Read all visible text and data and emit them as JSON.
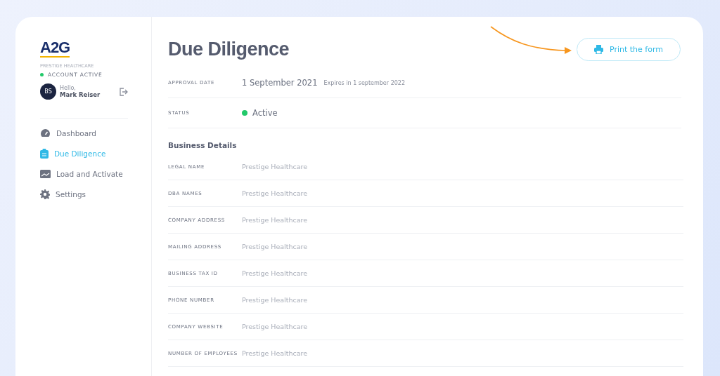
{
  "logo": {
    "text": "A2G"
  },
  "account": {
    "company": "PRESTIGE HEALTHCARE",
    "status": "ACCOUNT ACTIVE",
    "active": true,
    "initials": "BS",
    "greeting": "Hello,",
    "name": "Mark Reiser"
  },
  "nav": [
    {
      "kind": "dashboard",
      "label": "Dashboard",
      "selected": false
    },
    {
      "kind": "diligence",
      "label": "Due Diligence",
      "selected": true
    },
    {
      "kind": "load",
      "label": "Load and Activate",
      "selected": false
    },
    {
      "kind": "settings",
      "label": "Settings",
      "selected": false
    }
  ],
  "page": {
    "title": "Due Diligence",
    "print_button": "Print the form"
  },
  "approval": {
    "label": "APPROVAL DATE",
    "date": "1 September 2021",
    "expires": "Expires in 1 september 2022"
  },
  "status": {
    "label": "STATUS",
    "value": "Active",
    "active": true
  },
  "business": {
    "heading": "Business Details",
    "fields": [
      {
        "label": "LEGAL NAME",
        "value": "Prestige Healthcare"
      },
      {
        "label": "DBA NAMES",
        "value": "Prestige Healthcare"
      },
      {
        "label": "COMPANY ADDRESS",
        "value": "Prestige Healthcare"
      },
      {
        "label": "MAILING ADDRESS",
        "value": "Prestige Healthcare"
      },
      {
        "label": "BUSINESS TAX ID",
        "value": "Prestige Healthcare"
      },
      {
        "label": "PHONE NUMBER",
        "value": "Prestige Healthcare"
      },
      {
        "label": "COMPANY WEBSITE",
        "value": "Prestige Healthcare"
      },
      {
        "label": "NUMBER OF EMPLOYEES",
        "value": "Prestige Healthcare"
      }
    ]
  }
}
